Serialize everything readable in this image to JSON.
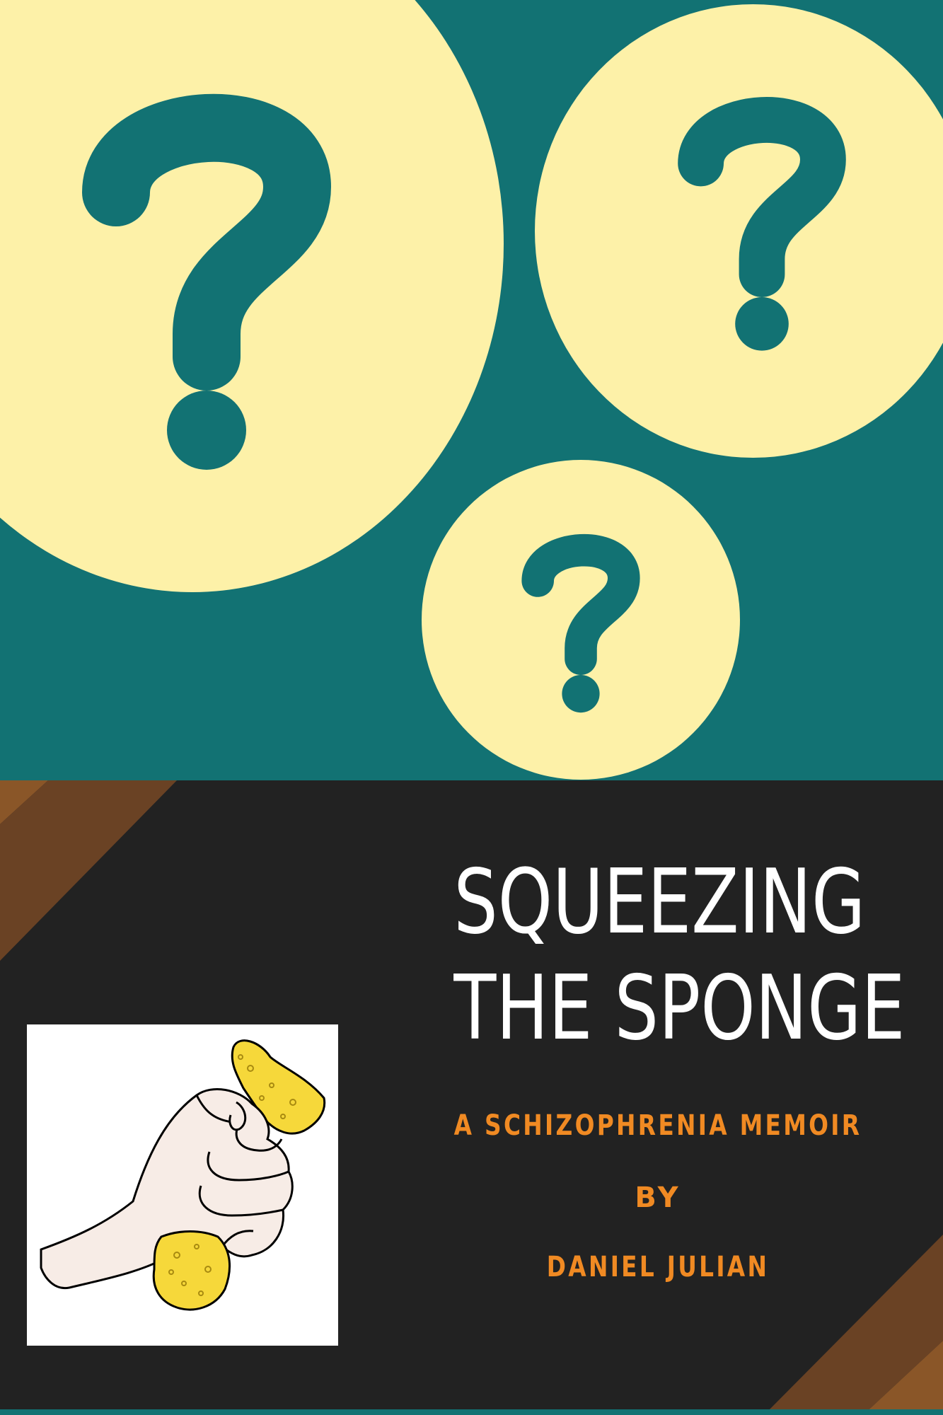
{
  "cover": {
    "title_line_1": "SQUEEZING",
    "title_line_2": "THE SPONGE",
    "subtitle": "A SCHIZOPHRENIA MEMOIR",
    "by": "BY",
    "author": "DANIEL JULIAN"
  },
  "icons": {
    "question_marks": [
      "question-mark-icon",
      "question-mark-icon",
      "question-mark-icon"
    ],
    "illustration": "hand-squeezing-sponge-illustration"
  },
  "colors": {
    "teal": "#127273",
    "cream": "#fdf1a8",
    "dark": "#222222",
    "orange": "#f08a23",
    "brown_dark": "#6a4224",
    "brown_light": "#8a5628",
    "white": "#ffffff"
  }
}
